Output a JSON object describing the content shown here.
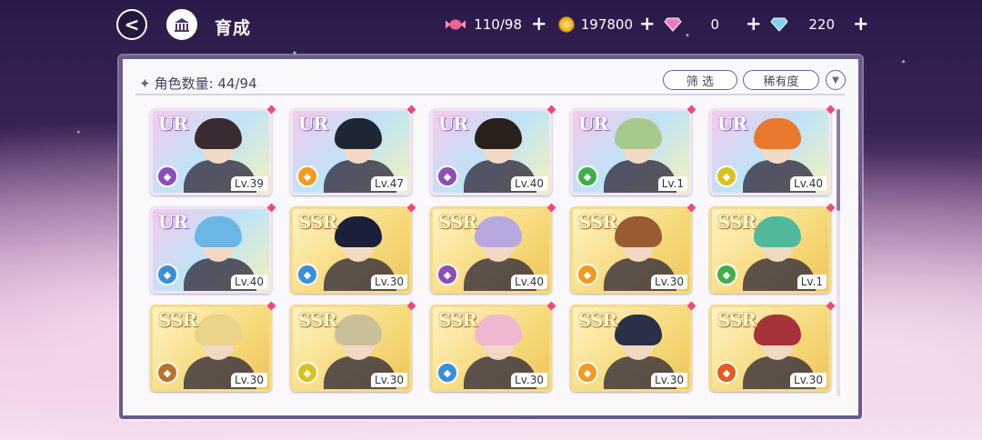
{
  "header": {
    "title": "育成",
    "back_label": "<",
    "home_icon": "building-icon"
  },
  "resources": [
    {
      "icon": "candy-icon",
      "value": "110/98"
    },
    {
      "icon": "gold-coin-icon",
      "value": "197800"
    },
    {
      "icon": "pink-diamond-icon",
      "value": "0"
    },
    {
      "icon": "blue-diamond-icon",
      "value": "220"
    }
  ],
  "panel": {
    "count_label": "角色数量: 44/94",
    "filter_label": "筛 选",
    "rarity_sort_label": "稀有度",
    "sort_toggle_icon": "chevron-down-icon"
  },
  "cards": [
    {
      "rarity": "UR",
      "level": "Lv.39",
      "element_color": "#8a4fb8",
      "hair": "#3a2a32"
    },
    {
      "rarity": "UR",
      "level": "Lv.47",
      "element_color": "#f39a1f",
      "hair": "#1f2633"
    },
    {
      "rarity": "UR",
      "level": "Lv.40",
      "element_color": "#8a4fb8",
      "hair": "#2a201c"
    },
    {
      "rarity": "UR",
      "level": "Lv.1",
      "element_color": "#3fae4a",
      "hair": "#a8c98c"
    },
    {
      "rarity": "UR",
      "level": "Lv.40",
      "element_color": "#d9c21f",
      "hair": "#e8792e"
    },
    {
      "rarity": "UR",
      "level": "Lv.40",
      "element_color": "#3a8fd8",
      "hair": "#6ab6e6"
    },
    {
      "rarity": "SSR",
      "level": "Lv.30",
      "element_color": "#3a8fd8",
      "hair": "#1a1f3a"
    },
    {
      "rarity": "SSR",
      "level": "Lv.40",
      "element_color": "#8a4fb8",
      "hair": "#b8a8e0"
    },
    {
      "rarity": "SSR",
      "level": "Lv.30",
      "element_color": "#f39a1f",
      "hair": "#9a5a32"
    },
    {
      "rarity": "SSR",
      "level": "Lv.1",
      "element_color": "#3fae4a",
      "hair": "#4fb89a"
    },
    {
      "rarity": "SSR",
      "level": "Lv.30",
      "element_color": "#b8742a",
      "hair": "#e9d48a"
    },
    {
      "rarity": "SSR",
      "level": "Lv.30",
      "element_color": "#d9c21f",
      "hair": "#c9c09a"
    },
    {
      "rarity": "SSR",
      "level": "Lv.30",
      "element_color": "#3a8fd8",
      "hair": "#f0b8d0"
    },
    {
      "rarity": "SSR",
      "level": "Lv.30",
      "element_color": "#f39a1f",
      "hair": "#2a3048"
    },
    {
      "rarity": "SSR",
      "level": "Lv.30",
      "element_color": "#e85a1f",
      "hair": "#a8323a"
    }
  ]
}
